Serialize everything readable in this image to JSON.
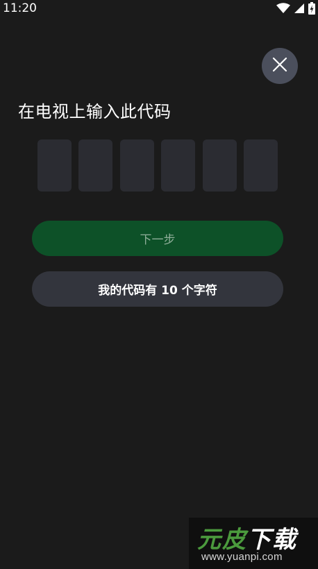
{
  "status_bar": {
    "time": "11:20",
    "icons": [
      "wifi-icon",
      "cellular-signal-icon",
      "battery-charging-icon"
    ]
  },
  "dialog": {
    "close_icon": "close-icon",
    "title": "在电视上输入此代码",
    "code_slots": [
      "",
      "",
      "",
      "",
      "",
      ""
    ],
    "next_button_label": "下一步",
    "ten_char_button_label": "我的代码有 10 个字符"
  },
  "colors": {
    "background": "#1b1b1b",
    "code_box": "#2b2c32",
    "next_button_bg": "#0d5128",
    "next_button_text": "#8fae99",
    "secondary_button_bg": "#33353d",
    "close_button_bg": "#4b4f5c"
  },
  "watermark": {
    "logo_part1": "元皮",
    "logo_part2": "下载",
    "url": "www.yuanpi.com"
  }
}
